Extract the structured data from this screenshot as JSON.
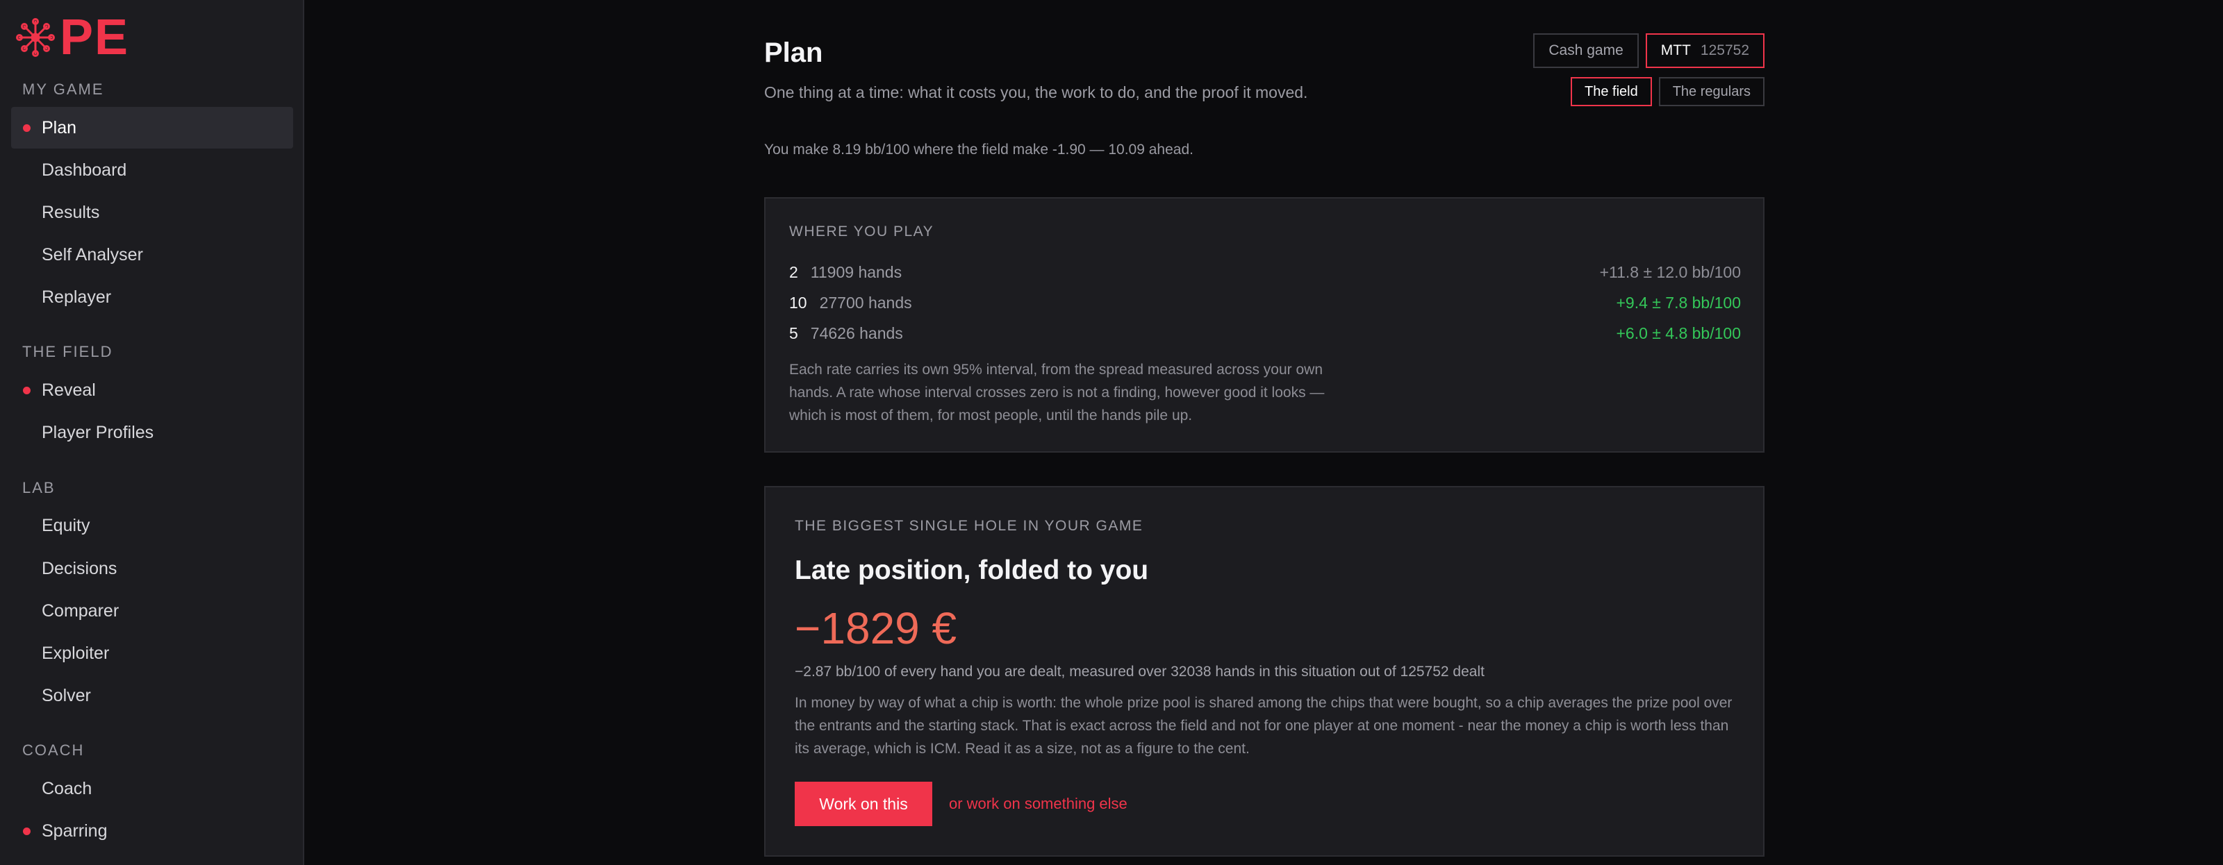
{
  "brand": {
    "text": "PE",
    "accent": "#f0344a"
  },
  "sidebar": {
    "sections": [
      {
        "label": "MY GAME"
      },
      {
        "label": "THE FIELD"
      },
      {
        "label": "LAB"
      },
      {
        "label": "COACH"
      }
    ],
    "items": [
      {
        "label": "Plan",
        "active": true,
        "dot": true
      },
      {
        "label": "Dashboard"
      },
      {
        "label": "Results"
      },
      {
        "label": "Self Analyser"
      },
      {
        "label": "Replayer"
      },
      {
        "label": "Reveal",
        "dot": true
      },
      {
        "label": "Player Profiles"
      },
      {
        "label": "Equity"
      },
      {
        "label": "Decisions"
      },
      {
        "label": "Comparer"
      },
      {
        "label": "Exploiter"
      },
      {
        "label": "Solver"
      },
      {
        "label": "Coach"
      },
      {
        "label": "Sparring",
        "dot": true
      }
    ]
  },
  "header": {
    "title": "Plan",
    "subtitle": "One thing at a time: what it costs you, the work to do, and the proof it moved.",
    "mode_toggle": {
      "cash": "Cash game",
      "mtt": "MTT",
      "mtt_count": "125752",
      "selected": "MTT"
    },
    "compare_toggle": {
      "field": "The field",
      "regulars": "The regulars",
      "selected": "The field"
    }
  },
  "summary": "You make 8.19 bb/100 where the field make -1.90 — 10.09 ahead.",
  "where_you_play": {
    "label": "WHERE YOU PLAY",
    "rows": [
      {
        "num": "2",
        "hands": "11909 hands",
        "rate": "+11.8 ± 12.0 bb/100",
        "significant": false
      },
      {
        "num": "10",
        "hands": "27700 hands",
        "rate": "+9.4 ± 7.8 bb/100",
        "significant": true
      },
      {
        "num": "5",
        "hands": "74626 hands",
        "rate": "+6.0 ± 4.8 bb/100",
        "significant": true
      }
    ],
    "note": "Each rate carries its own 95% interval, from the spread measured across your own hands. A rate whose interval crosses zero is not a finding, however good it looks — which is most of them, for most people, until the hands pile up."
  },
  "biggest_hole": {
    "label": "THE BIGGEST SINGLE HOLE IN YOUR GAME",
    "title": "Late position, folded to you",
    "amount": "−1829 €",
    "detail": "−2.87 bb/100 of every hand you are dealt, measured over 32038 hands in this situation out of 125752 dealt",
    "explanation": "In money by way of what a chip is worth: the whole prize pool is shared among the chips that were bought, so a chip averages the prize pool over the entrants and the starting stack. That is exact across the field and not for one player at one moment - near the money a chip is worth less than its average, which is ICM. Read it as a size, not as a figure to the cent.",
    "primary_button": "Work on this",
    "secondary_link": "or work on something else"
  }
}
